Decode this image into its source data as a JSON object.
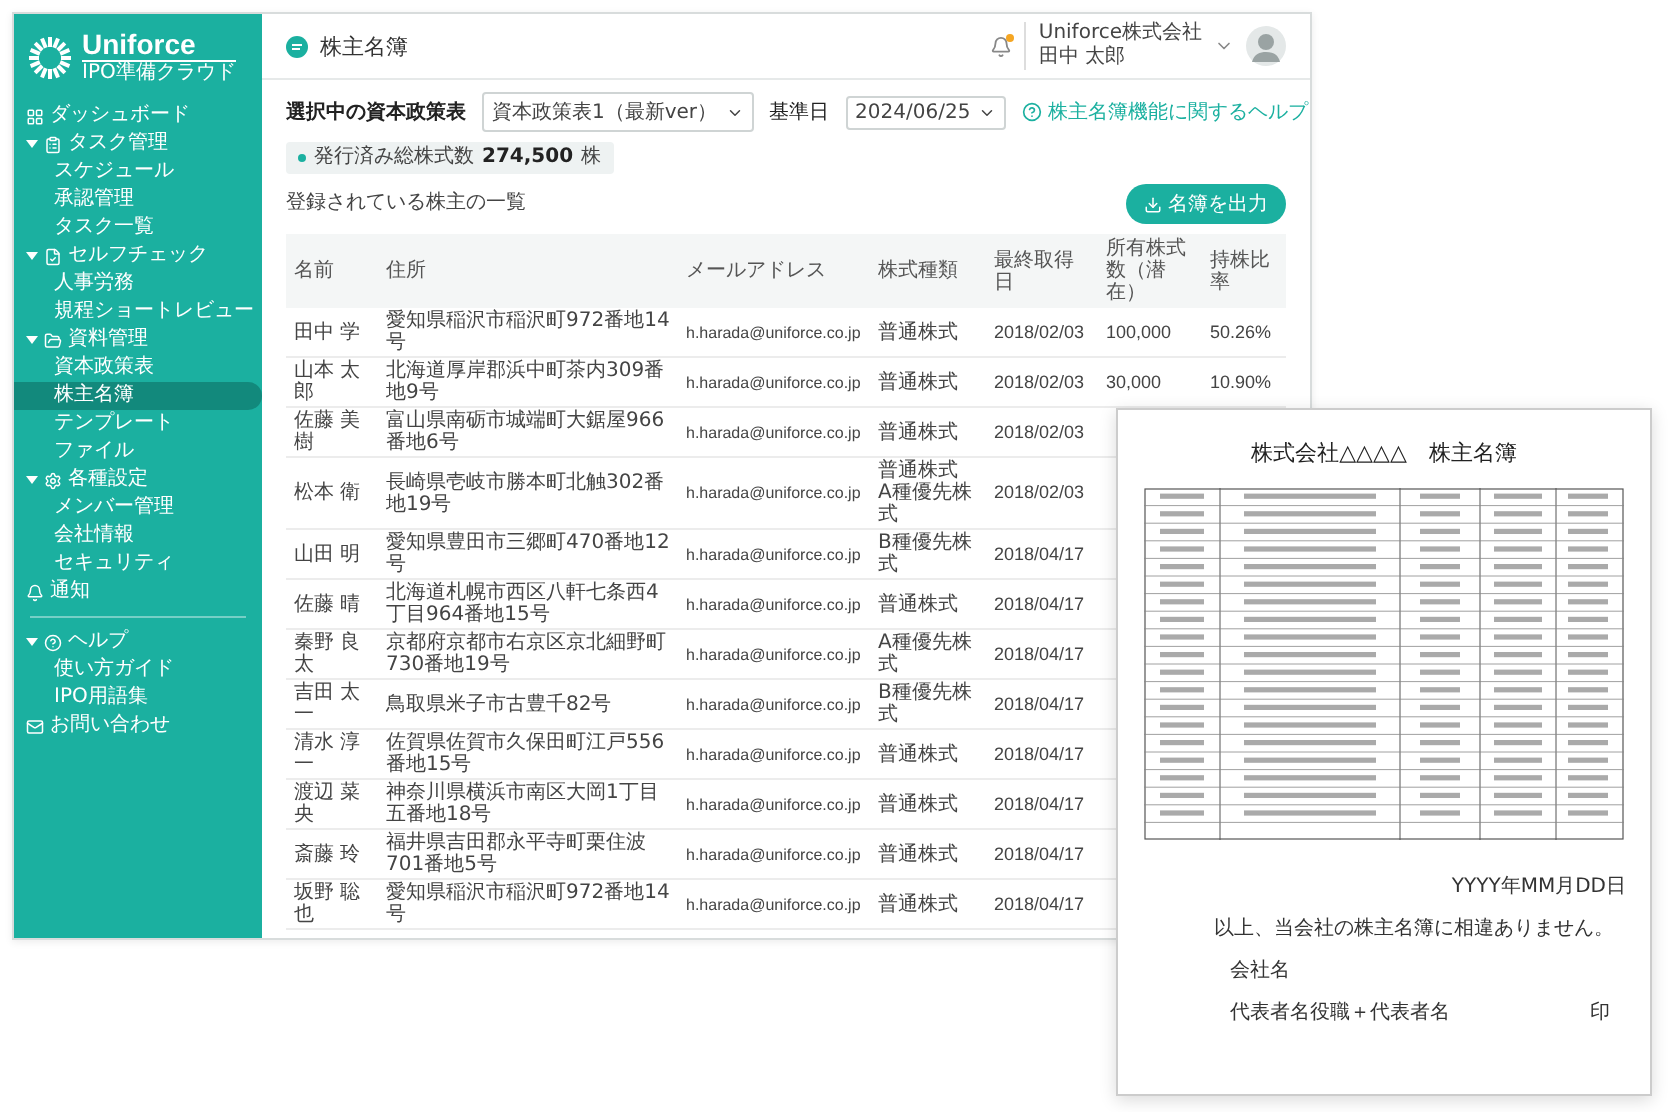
{
  "sidebar": {
    "logo": {
      "name": "Uniforce",
      "tagline": "IPO準備クラウド"
    },
    "items": [
      {
        "kind": "link",
        "label": "ダッシュボード"
      },
      {
        "kind": "group",
        "label": "タスク管理",
        "expanded": true,
        "children": [
          {
            "label": "スケジュール",
            "selected": false
          },
          {
            "label": "承認管理",
            "selected": false
          },
          {
            "label": "タスク一覧",
            "selected": false
          }
        ]
      },
      {
        "kind": "group",
        "label": "セルフチェック",
        "expanded": true,
        "children": [
          {
            "label": "人事労務",
            "selected": false
          },
          {
            "label": "規程ショートレビュー",
            "selected": false
          }
        ]
      },
      {
        "kind": "group",
        "label": "資料管理",
        "expanded": true,
        "children": [
          {
            "label": "資本政策表",
            "selected": false
          },
          {
            "label": "株主名簿",
            "selected": true
          },
          {
            "label": "テンプレート",
            "selected": false
          },
          {
            "label": "ファイル",
            "selected": false
          }
        ]
      },
      {
        "kind": "group",
        "label": "各種設定",
        "expanded": true,
        "children": [
          {
            "label": "メンバー管理",
            "selected": false
          },
          {
            "label": "会社情報",
            "selected": false
          },
          {
            "label": "セキュリティ",
            "selected": false
          }
        ]
      },
      {
        "kind": "link",
        "label": "通知"
      },
      {
        "kind": "divider"
      },
      {
        "kind": "group",
        "label": "ヘルプ",
        "expanded": true,
        "children": [
          {
            "label": "使い方ガイド",
            "selected": false
          },
          {
            "label": "IPO用語集",
            "selected": false
          }
        ]
      },
      {
        "kind": "link",
        "label": "お問い合わせ"
      }
    ]
  },
  "header": {
    "title": "株主名簿",
    "notification": true,
    "company": "Uniforce株式会社",
    "user": "田中 太郎"
  },
  "filters": {
    "plan_label": "選択中の資本政策表",
    "plan_value": "資本政策表1（最新ver）",
    "date_label": "基準日",
    "date_value": "2024/06/25",
    "help_link": "株主名簿機能に関するヘルプ"
  },
  "summary": {
    "label": "発行済み総株式数",
    "value": "274,500",
    "unit": "株"
  },
  "list": {
    "title": "登録されている株主の一覧",
    "export_button": "名簿を出力"
  },
  "table": {
    "columns": [
      "名前",
      "住所",
      "メールアドレス",
      "株式種類",
      "最終取得日",
      "所有株式数（潜在）",
      "持株比率"
    ],
    "rows": [
      {
        "name": "田中 学",
        "address": "愛知県稲沢市稲沢町972番地14号",
        "email": "h.harada@uniforce.co.jp",
        "types": [
          "普通株式"
        ],
        "date": "2018/02/03",
        "shares": "100,000",
        "ratio": "50.26%"
      },
      {
        "name": "山本 太郎",
        "address": "北海道厚岸郡浜中町茶内309番地9号",
        "email": "h.harada@uniforce.co.jp",
        "types": [
          "普通株式"
        ],
        "date": "2018/02/03",
        "shares": "30,000",
        "ratio": "10.90%"
      },
      {
        "name": "佐藤 美樹",
        "address": "富山県南砺市城端町大鋸屋966番地6号",
        "email": "h.harada@uniforce.co.jp",
        "types": [
          "普通株式"
        ],
        "date": "2018/02/03"
      },
      {
        "name": "松本 衛",
        "address": "長崎県壱岐市勝本町北触302番地19号",
        "email": "h.harada@uniforce.co.jp",
        "types": [
          "普通株式",
          "A種優先株式"
        ],
        "date": "2018/02/03"
      },
      {
        "name": "山田 明",
        "address": "愛知県豊田市三郷町470番地12号",
        "email": "h.harada@uniforce.co.jp",
        "types": [
          "B種優先株式"
        ],
        "date": "2018/04/17"
      },
      {
        "name": "佐藤 晴",
        "address": "北海道札幌市西区八軒七条西4丁目964番地15号",
        "email": "h.harada@uniforce.co.jp",
        "types": [
          "普通株式"
        ],
        "date": "2018/04/17"
      },
      {
        "name": "秦野 良太",
        "address": "京都府京都市右京区京北細野町730番地19号",
        "email": "h.harada@uniforce.co.jp",
        "types": [
          "A種優先株式"
        ],
        "date": "2018/04/17"
      },
      {
        "name": "吉田 太一",
        "address": "鳥取県米子市古豊千82号",
        "email": "h.harada@uniforce.co.jp",
        "types": [
          "B種優先株式"
        ],
        "date": "2018/04/17"
      },
      {
        "name": "清水 淳一",
        "address": "佐賀県佐賀市久保田町江戸556番地15号",
        "email": "h.harada@uniforce.co.jp",
        "types": [
          "普通株式"
        ],
        "date": "2018/04/17"
      },
      {
        "name": "渡辺 菜央",
        "address": "神奈川県横浜市南区大岡1丁目五番地18号",
        "email": "h.harada@uniforce.co.jp",
        "types": [
          "普通株式"
        ],
        "date": "2018/04/17"
      },
      {
        "name": "斎藤 玲",
        "address": "福井県吉田郡永平寺町栗住波701番地5号",
        "email": "h.harada@uniforce.co.jp",
        "types": [
          "普通株式"
        ],
        "date": "2018/04/17"
      },
      {
        "name": "坂野 聡也",
        "address": "愛知県稲沢市稲沢町972番地14号",
        "email": "h.harada@uniforce.co.jp",
        "types": [
          "普通株式"
        ],
        "date": "2018/04/17"
      }
    ]
  },
  "document": {
    "title": "株式会社△△△△　株主名簿",
    "date": "YYYY年MM月DD日",
    "statement": "以上、当会社の株主名簿に相違ありません。",
    "company_label": "会社名",
    "representative_label": "代表者名役職＋代表者名",
    "seal": "印"
  }
}
